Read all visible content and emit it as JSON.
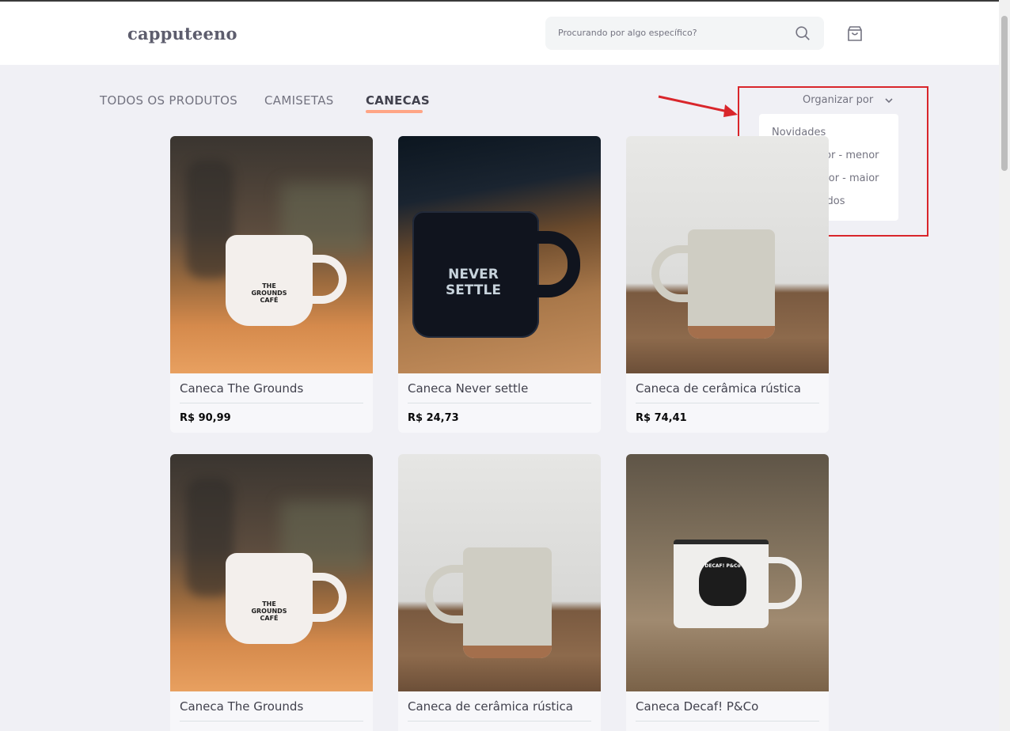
{
  "header": {
    "logo": "capputeeno",
    "search_placeholder": "Procurando por algo específico?"
  },
  "tabs": [
    {
      "label": "TODOS OS PRODUTOS",
      "active": false
    },
    {
      "label": "CAMISETAS",
      "active": false
    },
    {
      "label": "CANECAS",
      "active": true
    }
  ],
  "sort": {
    "label": "Organizar por",
    "options": [
      "Novidades",
      "Preço: Maior - menor",
      "Preço: Menor - maior",
      "Mais vendidos"
    ]
  },
  "products": [
    {
      "name": "Caneca The Grounds",
      "price": "R$ 90,99",
      "mug_text": "THE GROUNDS CAFÉ"
    },
    {
      "name": "Caneca Never settle",
      "price": "R$ 24,73",
      "mug_text": "NEVER SETTLE"
    },
    {
      "name": "Caneca de cerâmica rústica",
      "price": "R$ 74,41"
    },
    {
      "name": "Caneca The Grounds",
      "mug_text": "THE GROUNDS CAFÉ"
    },
    {
      "name": "Caneca de cerâmica rústica"
    },
    {
      "name": "Caneca Decaf! P&Co",
      "mug_text": "DECAF! P&Co"
    }
  ],
  "colors": {
    "accent_underline": "#ffa585",
    "highlight_box": "#d9262b"
  }
}
